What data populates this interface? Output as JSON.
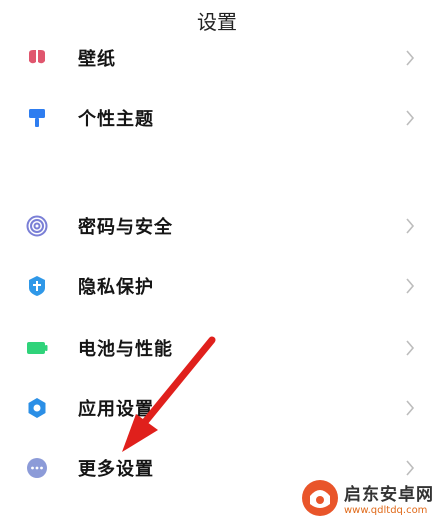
{
  "header": {
    "title": "设置"
  },
  "items": [
    {
      "label": "壁纸",
      "icon": "wallpaper-icon",
      "color": "#e0566e"
    },
    {
      "label": "个性主题",
      "icon": "theme-brush-icon",
      "color": "#2e7df0"
    },
    {
      "label": "密码与安全",
      "icon": "fingerprint-icon",
      "color": "#7a7fd6"
    },
    {
      "label": "隐私保护",
      "icon": "privacy-shield-icon",
      "color": "#2f98e8"
    },
    {
      "label": "电池与性能",
      "icon": "battery-icon",
      "color": "#2fd37a"
    },
    {
      "label": "应用设置",
      "icon": "gear-icon",
      "color": "#2b8fe6"
    },
    {
      "label": "更多设置",
      "icon": "more-dots-icon",
      "color": "#8c9bd8"
    }
  ],
  "annotation": {
    "arrow_color": "#e0201c"
  },
  "watermark": {
    "name": "启东安卓网",
    "url": "www.qdltdq.com",
    "brand_color": "#e9552a"
  }
}
